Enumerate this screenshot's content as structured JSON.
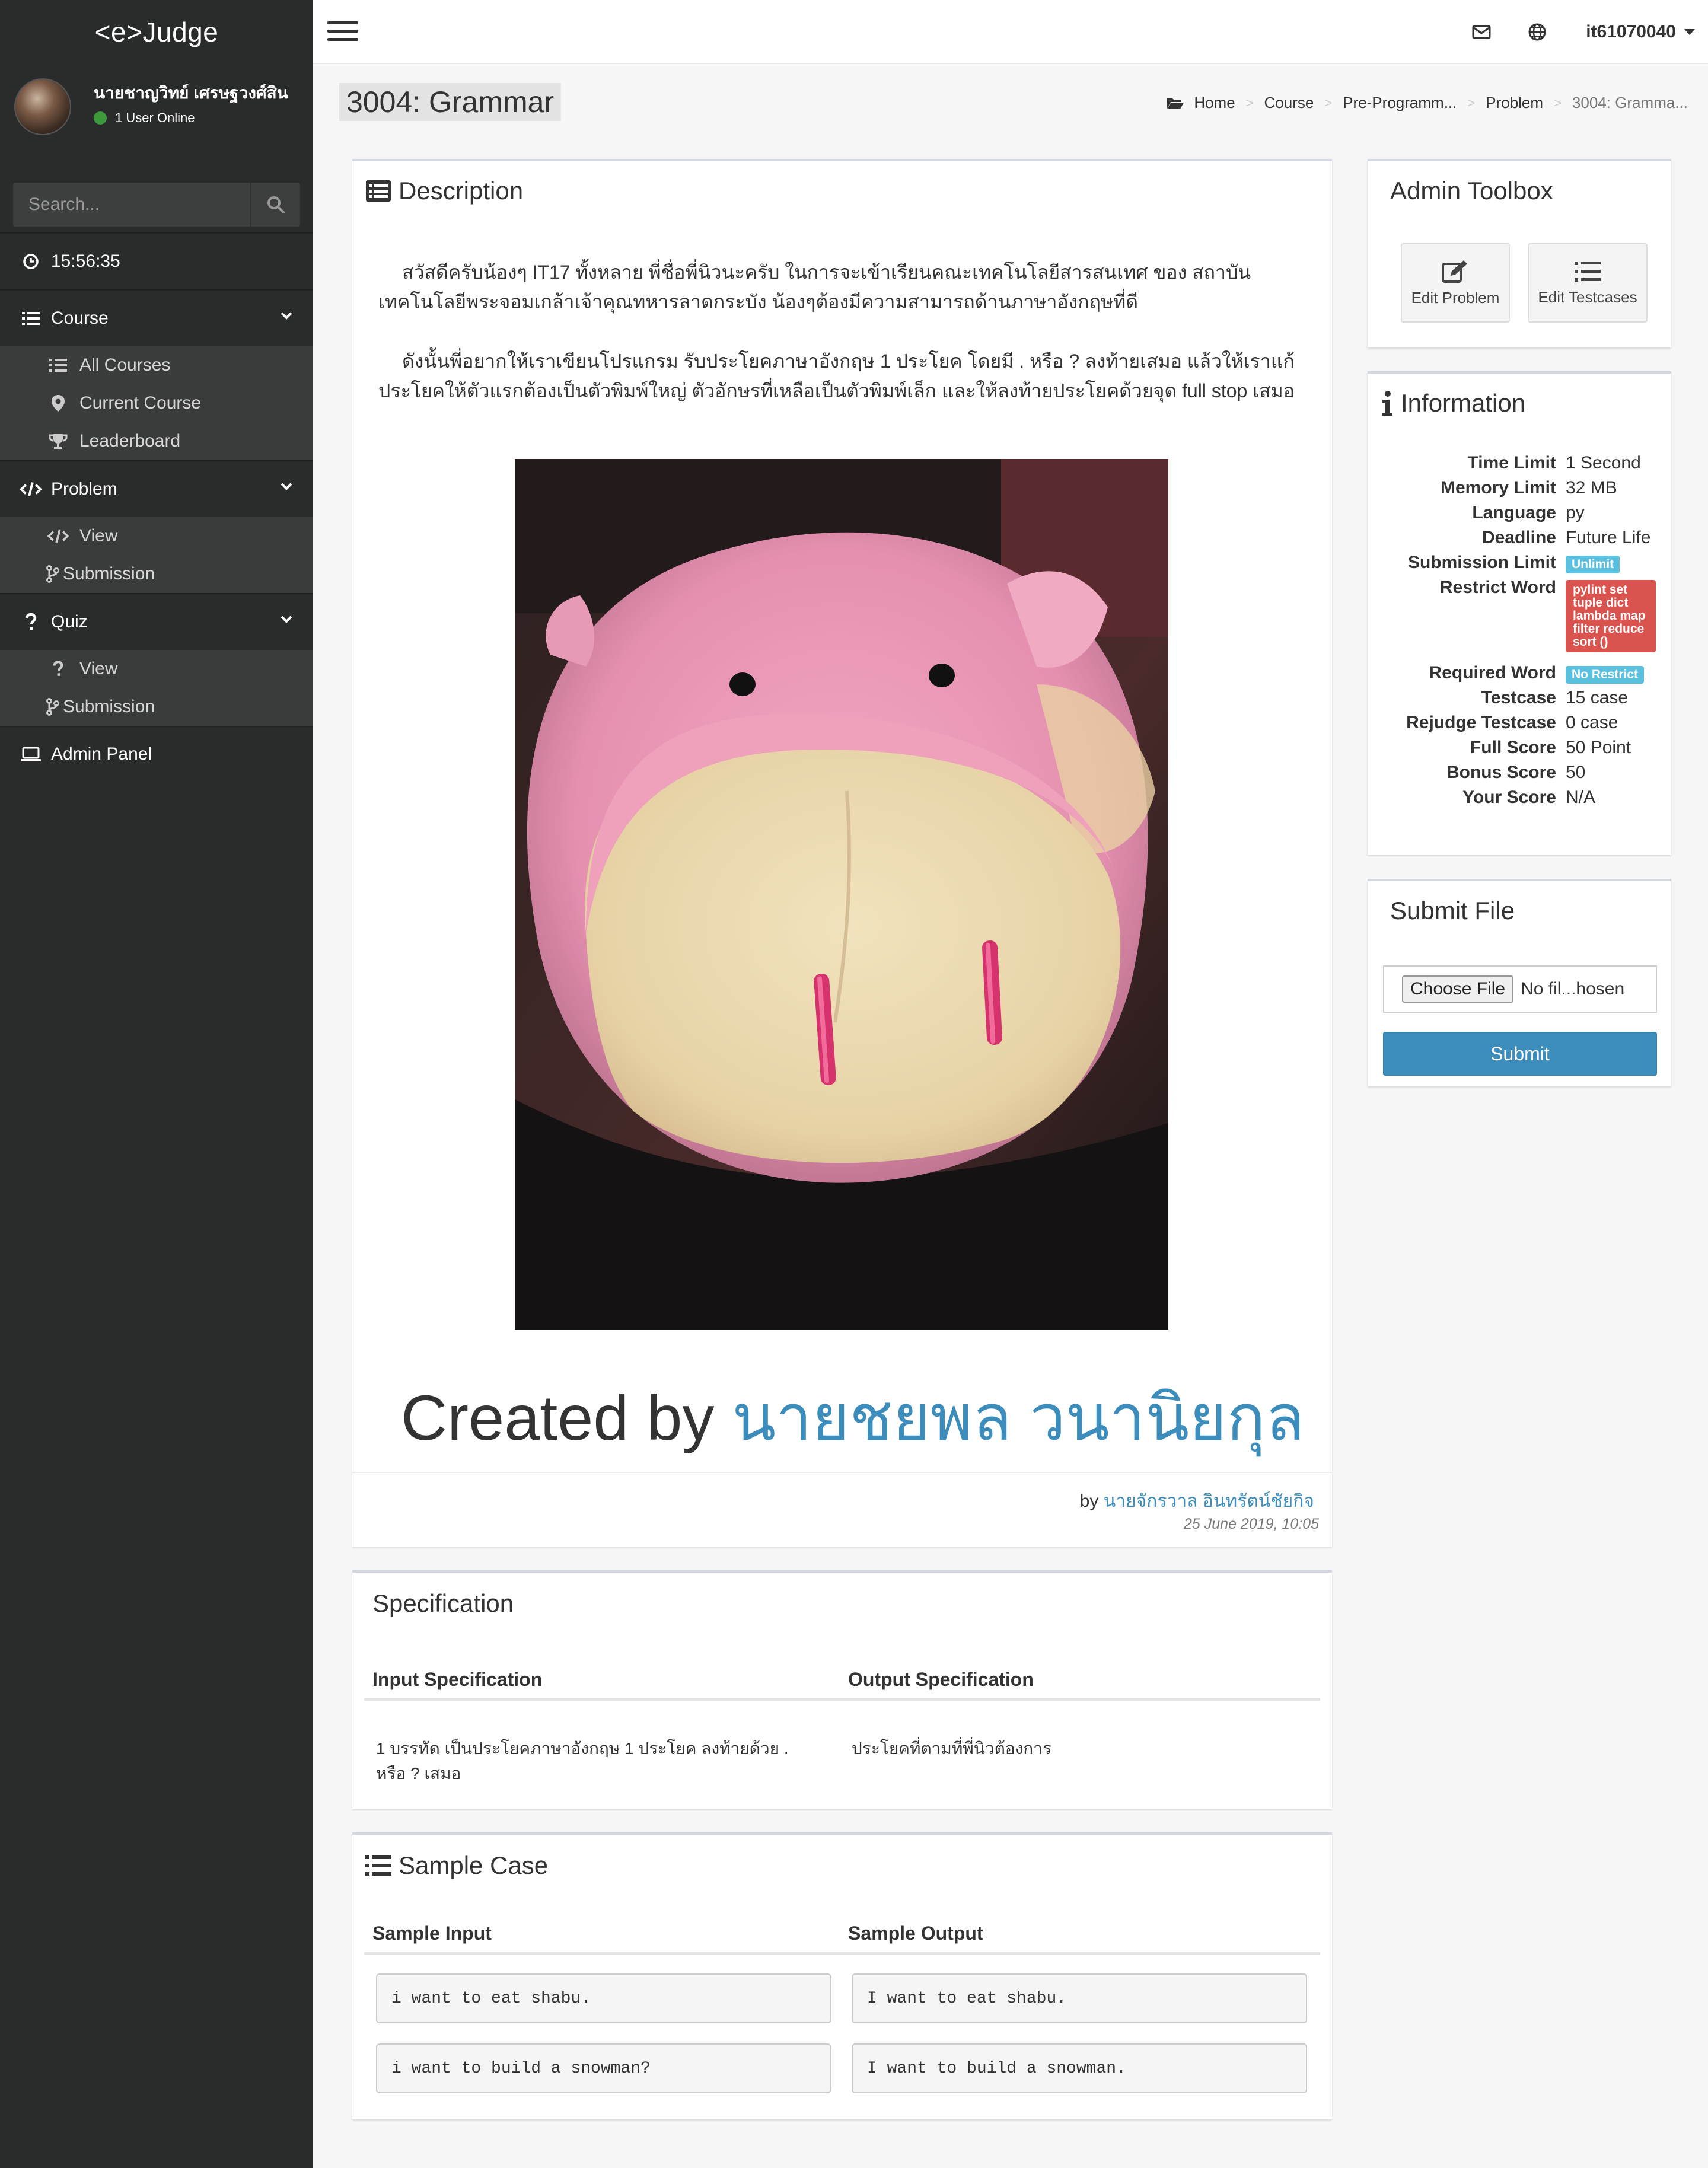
{
  "app": {
    "brand": "<e>Judge"
  },
  "user": {
    "name": "นายชาญวิทย์ เศรษฐวงศ์สิน",
    "online": "1 User Online"
  },
  "search": {
    "placeholder": "Search..."
  },
  "sidebar": {
    "clock": "15:56:35",
    "course": {
      "label": "Course",
      "items": [
        "All Courses",
        "Current Course",
        "Leaderboard"
      ]
    },
    "problem": {
      "label": "Problem",
      "items": [
        "View",
        "Submission"
      ]
    },
    "quiz": {
      "label": "Quiz",
      "items": [
        "View",
        "Submission"
      ]
    },
    "admin": "Admin Panel"
  },
  "topbar": {
    "username": "it61070040"
  },
  "page": {
    "title": "3004: Grammar"
  },
  "breadcrumb": [
    "Home",
    "Course",
    "Pre-Programm...",
    "Problem",
    "3004: Gramma..."
  ],
  "description": {
    "title": "Description",
    "p1": "สวัสดีครับน้องๆ IT17 ทั้งหลาย พี่ชื่อพี่นิวนะครับ ในการจะเข้าเรียนคณะเทคโนโลยีสารสนเทศ ของ สถาบันเทคโนโลยีพระจอมเกล้าเจ้าคุณทหารลาดกระบัง น้องๆต้องมีความสามารถด้านภาษาอังกฤษที่ดี",
    "p2": "ดังนั้นพี่อยากให้เราเขียนโปรแกรม รับประโยคภาษาอังกฤษ 1 ประโยค โดยมี . หรือ ? ลงท้ายเสมอ แล้วให้เราแก้ประโยคให้ตัวแรกต้องเป็นตัวพิมพ์ใหญ่ ตัวอักษรที่เหลือเป็นตัวพิมพ์เล็ก และให้ลงท้ายประโยคด้วยจุด full stop เสมอ",
    "created_prefix": "Created by",
    "created_name": "นายชยพล วนานิยกุล",
    "by": "by",
    "author": "นายจักรวาล อินทรัตน์ชัยกิจ",
    "date": "25 June 2019, 10:05"
  },
  "specification": {
    "title": "Specification",
    "input_header": "Input Specification",
    "output_header": "Output Specification",
    "input": "1 บรรทัด เป็นประโยคภาษาอังกฤษ 1 ประโยค ลงท้ายด้วย . หรือ ? เสมอ",
    "output": "ประโยคที่ตามที่พี่นิวต้องการ"
  },
  "samples": {
    "title": "Sample Case",
    "input_header": "Sample Input",
    "output_header": "Sample Output",
    "cases": [
      {
        "input": "i want to eat shabu.",
        "output": "I want to eat shabu."
      },
      {
        "input": "i want to build a snowman?",
        "output": "I want to build a snowman."
      }
    ]
  },
  "toolbox": {
    "title": "Admin Toolbox",
    "edit_problem": "Edit Problem",
    "edit_testcases": "Edit Testcases"
  },
  "information": {
    "title": "Information",
    "rows": [
      {
        "key": "Time Limit",
        "value": "1 Second"
      },
      {
        "key": "Memory Limit",
        "value": "32 MB"
      },
      {
        "key": "Language",
        "value": "py"
      },
      {
        "key": "Deadline",
        "value": "Future Life"
      },
      {
        "key": "Submission Limit",
        "badge": "Unlimit"
      },
      {
        "key": "Restrict Word",
        "badge": "pylint set tuple dict lambda map filter reduce sort ()"
      },
      {
        "key": "Required Word",
        "badge": "No Restrict"
      },
      {
        "key": "Testcase",
        "value": "15 case"
      },
      {
        "key": "Rejudge Testcase",
        "value": "0 case"
      },
      {
        "key": "Full Score",
        "value": "50 Point"
      },
      {
        "key": "Bonus Score",
        "value": "50"
      },
      {
        "key": "Your Score",
        "value": "N/A"
      }
    ]
  },
  "submit": {
    "title": "Submit File",
    "choose": "Choose File",
    "no_file": "No fil...hosen",
    "submit": "Submit"
  },
  "colors": {
    "sidebar": "#2a2b2b",
    "accent": "#3c8dbc",
    "info_badge": "#5bc0de",
    "danger_badge": "#d9534f"
  }
}
